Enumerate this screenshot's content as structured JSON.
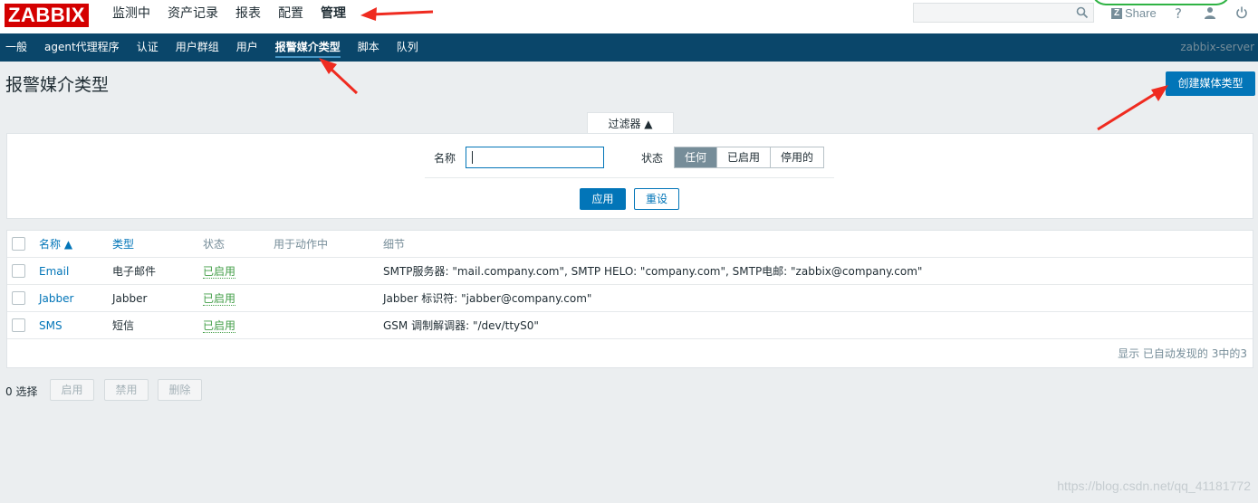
{
  "topbar": {
    "logo": "ZABBIX",
    "menu": [
      "监测中",
      "资产记录",
      "报表",
      "配置",
      "管理"
    ],
    "share": "Share",
    "help": "?"
  },
  "submenu": {
    "items": [
      "一般",
      "agent代理程序",
      "认证",
      "用户群组",
      "用户",
      "报警媒介类型",
      "脚本",
      "队列"
    ],
    "server": "zabbix-server"
  },
  "page": {
    "title": "报警媒介类型",
    "create_button": "创建媒体类型"
  },
  "filter": {
    "tab_label": "过滤器 ▲",
    "name_label": "名称",
    "name_value": "",
    "status_label": "状态",
    "status_options": [
      "任何",
      "已启用",
      "停用的"
    ],
    "apply": "应用",
    "reset": "重设"
  },
  "table": {
    "headers": {
      "name": "名称 ▲",
      "type": "类型",
      "status": "状态",
      "used_in_actions": "用于动作中",
      "details": "细节"
    },
    "rows": [
      {
        "name": "Email",
        "type": "电子邮件",
        "status": "已启用",
        "details": "SMTP服务器: \"mail.company.com\", SMTP HELO: \"company.com\", SMTP电邮: \"zabbix@company.com\""
      },
      {
        "name": "Jabber",
        "type": "Jabber",
        "status": "已启用",
        "details": "Jabber 标识符: \"jabber@company.com\""
      },
      {
        "name": "SMS",
        "type": "短信",
        "status": "已启用",
        "details": "GSM 调制解调器: \"/dev/ttyS0\""
      }
    ],
    "footer": "显示 已自动发现的 3中的3"
  },
  "actions": {
    "selected": "0 选择",
    "enable": "启用",
    "disable": "禁用",
    "delete": "删除"
  },
  "watermark": "https://blog.csdn.net/qq_41181772",
  "colors": {
    "brand_red": "#d40000",
    "nav_blue": "#0a466a",
    "accent": "#0275b8",
    "enabled_green": "#429e47"
  }
}
